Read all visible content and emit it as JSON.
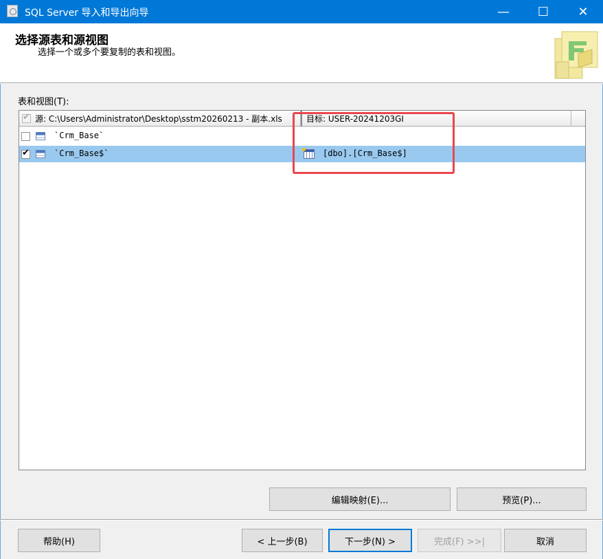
{
  "window": {
    "title": "SQL Server 导入和导出向导",
    "minimize_glyph": "—",
    "maximize_glyph": "☐",
    "close_glyph": "✕"
  },
  "header": {
    "title": "选择源表和源视图",
    "subtitle": "选择一个或多个要复制的表和视图。"
  },
  "list": {
    "label": "表和视图(T):",
    "columns": {
      "source": "源: C:\\Users\\Administrator\\Desktop\\sstm20260213 - 副本.xls",
      "target": "目标: USER-20241203GI"
    },
    "header_checked": true,
    "rows": [
      {
        "source": "`Crm_Base`",
        "target": "",
        "checked": false,
        "selected": false
      },
      {
        "source": "`Crm_Base$`",
        "target": "[dbo].[Crm_Base$]",
        "checked": true,
        "selected": true
      }
    ]
  },
  "buttons": {
    "edit_mappings": "编辑映射(E)...",
    "preview": "预览(P)...",
    "help": "帮助(H)",
    "back": "< 上一步(B)",
    "next": "下一步(N) >",
    "finish": "完成(F) >>|",
    "cancel": "取消"
  },
  "check_glyph": "✔",
  "colors": {
    "titlebar": "#0078d7",
    "selection": "#99c9ef",
    "highlight_box": "#e8464d"
  }
}
